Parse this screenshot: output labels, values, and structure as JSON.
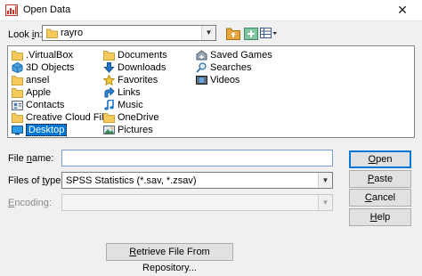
{
  "window": {
    "title": "Open Data",
    "close_glyph": "✕"
  },
  "look_in": {
    "label_prefix": "Look ",
    "label_underlined": "i",
    "label_suffix": "n:",
    "value": "rayro"
  },
  "toolbar": {
    "icons": [
      "up-folder-icon",
      "new-folder-icon",
      "view-menu-icon"
    ]
  },
  "files": {
    "items": [
      {
        "label": ".VirtualBox",
        "icon": "folder-icon"
      },
      {
        "label": "3D Objects",
        "icon": "3d-objects-icon"
      },
      {
        "label": "ansel",
        "icon": "folder-icon"
      },
      {
        "label": "Apple",
        "icon": "folder-icon"
      },
      {
        "label": "Contacts",
        "icon": "contacts-icon"
      },
      {
        "label": "Creative Cloud Files",
        "icon": "folder-icon"
      },
      {
        "label": "Desktop",
        "icon": "desktop-icon",
        "selected": true
      },
      {
        "label": "Documents",
        "icon": "folder-icon"
      },
      {
        "label": "Downloads",
        "icon": "downloads-icon"
      },
      {
        "label": "Favorites",
        "icon": "favorites-icon"
      },
      {
        "label": "Links",
        "icon": "links-icon"
      },
      {
        "label": "Music",
        "icon": "music-icon"
      },
      {
        "label": "OneDrive",
        "icon": "folder-icon"
      },
      {
        "label": "Pictures",
        "icon": "pictures-icon"
      },
      {
        "label": "Saved Games",
        "icon": "saved-games-icon"
      },
      {
        "label": "Searches",
        "icon": "searches-icon"
      },
      {
        "label": "Videos",
        "icon": "videos-icon"
      }
    ]
  },
  "file_name": {
    "label_prefix": "File ",
    "label_underlined": "n",
    "label_suffix": "ame:",
    "value": ""
  },
  "files_of_type": {
    "label_prefix": "Files of ",
    "label_underlined": "t",
    "label_suffix": "ype:",
    "value": "SPSS Statistics (*.sav, *.zsav)"
  },
  "encoding": {
    "label_prefix": "",
    "label_underlined": "E",
    "label_suffix": "ncoding:",
    "value": ""
  },
  "buttons": {
    "open": {
      "u": "O",
      "rest": "pen"
    },
    "paste": {
      "u": "P",
      "rest": "aste"
    },
    "cancel": {
      "u": "C",
      "rest": "ancel"
    },
    "help": {
      "u": "H",
      "rest": "elp"
    },
    "repository": {
      "u": "R",
      "rest": "etrieve File From Repository..."
    }
  },
  "colors": {
    "selection": "#0078d7",
    "folder": "#f5c95a",
    "window_bg": "#f0f0f0"
  }
}
